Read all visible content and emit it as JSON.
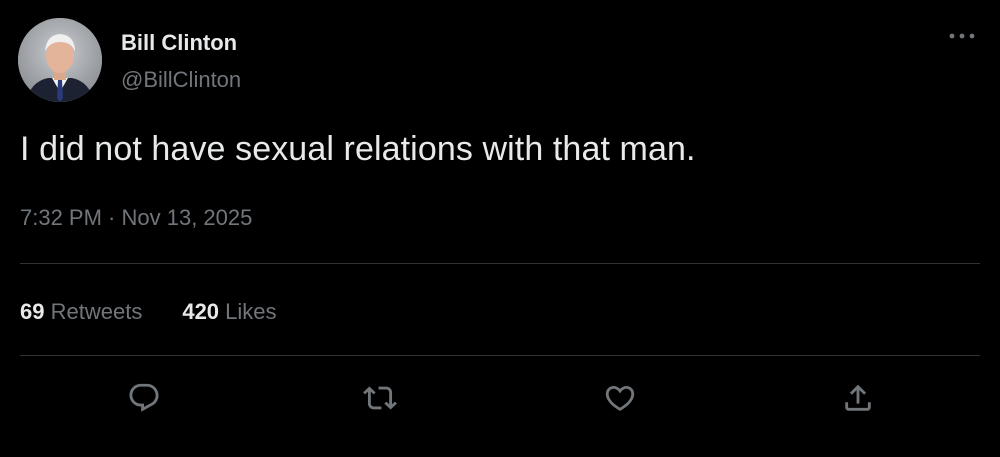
{
  "author": {
    "display_name": "Bill Clinton",
    "handle": "@BillClinton",
    "avatar_icon": "profile-photo"
  },
  "tweet": {
    "text": "I did not have sexual relations with that man.",
    "timestamp": "7:32 PM · Nov 13, 2025"
  },
  "stats": {
    "retweets_count": "69",
    "retweets_label": "Retweets",
    "likes_count": "420",
    "likes_label": "Likes"
  },
  "actions": [
    {
      "icon": "reply-icon"
    },
    {
      "icon": "retweet-icon"
    },
    {
      "icon": "like-icon"
    },
    {
      "icon": "share-icon"
    }
  ],
  "menu": {
    "icon": "more-options-icon"
  },
  "colors": {
    "background": "#000000",
    "primary_text": "#e7e9ea",
    "secondary_text": "#71767b",
    "divider": "#2f3336",
    "icon": "#71767b"
  }
}
